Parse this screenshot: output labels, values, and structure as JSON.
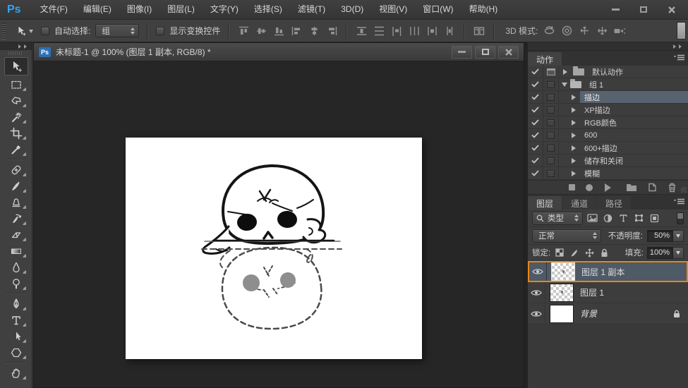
{
  "app": {
    "logo": "Ps"
  },
  "menubar": {
    "items": [
      "文件(F)",
      "编辑(E)",
      "图像(I)",
      "图层(L)",
      "文字(Y)",
      "选择(S)",
      "滤镜(T)",
      "3D(D)",
      "视图(V)",
      "窗口(W)",
      "帮助(H)"
    ]
  },
  "options_bar": {
    "auto_select_label": "自动选择:",
    "auto_select_value": "组",
    "show_transform_label": "显示变换控件",
    "mode_3d_label": "3D 模式:"
  },
  "document": {
    "badge": "Ps",
    "tab_title": "未标题-1 @ 100% (图层 1 副本, RGB/8) *"
  },
  "actions_panel": {
    "title": "动作",
    "items": [
      {
        "label": "默认动作",
        "type": "set",
        "checked": true,
        "modal": true,
        "expanded": false
      },
      {
        "label": "组 1",
        "type": "set",
        "checked": true,
        "modal": false,
        "expanded": true
      },
      {
        "label": "描边",
        "type": "action",
        "checked": true,
        "selected": true
      },
      {
        "label": "XP描边",
        "type": "action",
        "checked": true
      },
      {
        "label": "RGB颜色",
        "type": "action",
        "checked": true
      },
      {
        "label": "600",
        "type": "action",
        "checked": true
      },
      {
        "label": "600+描边",
        "type": "action",
        "checked": true
      },
      {
        "label": "储存和关闭",
        "type": "action",
        "checked": true
      },
      {
        "label": "模糊",
        "type": "action",
        "checked": true
      }
    ]
  },
  "layers_panel": {
    "tabs": [
      "图层",
      "通道",
      "路径"
    ],
    "filter_label": "类型",
    "blend_mode": "正常",
    "opacity_label": "不透明度:",
    "opacity_value": "50%",
    "lock_label": "锁定:",
    "fill_label": "填充:",
    "fill_value": "100%",
    "layers": [
      {
        "name": "图层 1 副本",
        "selected": true,
        "thumb": "checker"
      },
      {
        "name": "图层 1",
        "selected": false,
        "thumb": "checker"
      },
      {
        "name": "背景",
        "selected": false,
        "thumb": "white",
        "locked": true
      }
    ]
  },
  "colors": {
    "accent_orange": "#e8861c",
    "selection_blue": "#57636f",
    "ps_blue": "#31a5f5"
  }
}
